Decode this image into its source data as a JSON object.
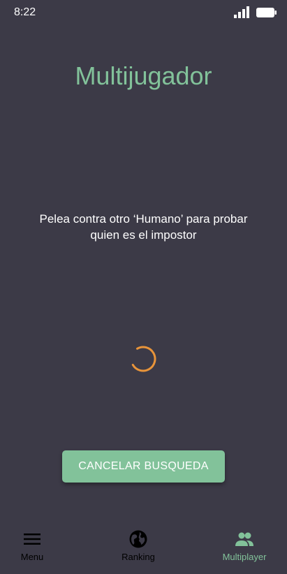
{
  "status_bar": {
    "time": "8:22"
  },
  "title": "Multijugador",
  "description": "Pelea contra otro ‘Humano’ para probar quien es el impostor",
  "cancel_button": {
    "label": "CANCELAR BUSQUEDA"
  },
  "bottom_nav": {
    "items": [
      {
        "label": "Menu",
        "icon": "menu-icon",
        "active": false
      },
      {
        "label": "Ranking",
        "icon": "globe-icon",
        "active": false
      },
      {
        "label": "Multiplayer",
        "icon": "people-icon",
        "active": true
      }
    ]
  },
  "colors": {
    "background": "#3c3a47",
    "accent": "#82c29a",
    "spinner": "#e8943a"
  }
}
